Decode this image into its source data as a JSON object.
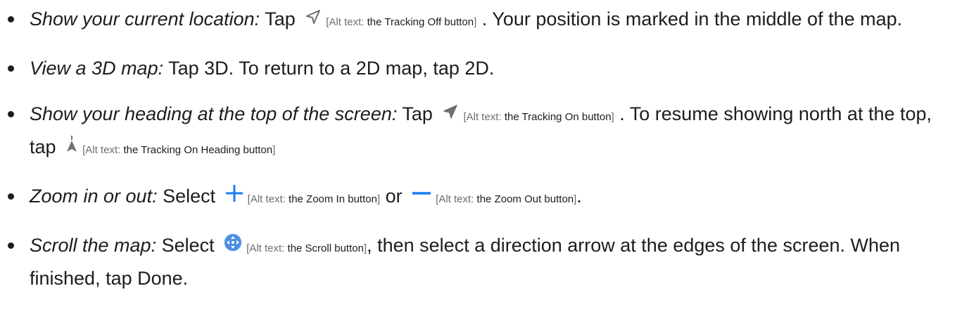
{
  "items": [
    {
      "lead": "Show your current location:",
      "t1": "Tap",
      "icon": "tracking-off-arrow-icon",
      "alt_label": "Alt text:",
      "alt": "the Tracking Off button",
      "t2": ". Your position is marked in the middle of the map."
    },
    {
      "lead": "View a 3D map:",
      "t1": "Tap 3D. To return to a 2D map, tap 2D."
    },
    {
      "lead": "Show your heading at the top of the screen:",
      "t1": "Tap",
      "icon": "tracking-on-arrow-icon",
      "alt_label": "Alt text:",
      "alt": "the Tracking On button",
      "t2": ". To resume showing north at the top, tap",
      "icon2": "tracking-on-heading-icon",
      "alt2_label": "Alt text:",
      "alt2": "the Tracking On Heading button"
    },
    {
      "lead": "Zoom in or out:",
      "t1": "Select",
      "icon": "zoom-in-plus-icon",
      "alt_label": "Alt text:",
      "alt": "the Zoom In button",
      "t2": "or",
      "icon2": "zoom-out-minus-icon",
      "alt2_label": "Alt text:",
      "alt2": "the Zoom Out button",
      "t3": "."
    },
    {
      "lead": "Scroll the map:",
      "t1": "Select",
      "icon": "scroll-icon",
      "alt_label": "Alt text:",
      "alt": "the Scroll button",
      "t2": ", then select a direction arrow at the edges of the screen. When finished, tap Done."
    }
  ],
  "colors": {
    "text": "#1d1d1f",
    "alt_gray": "#6e6e73",
    "icon_gray": "#6e6e73",
    "zoom_blue": "#1a7cf5",
    "scroll_blue": "#4a90e2"
  }
}
